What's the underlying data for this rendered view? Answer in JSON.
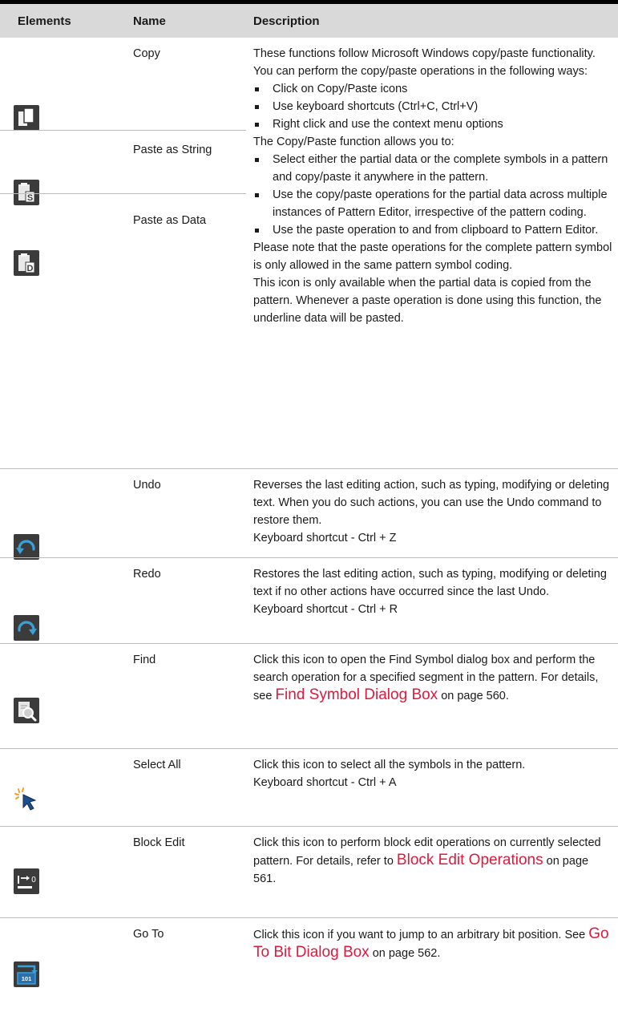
{
  "header": {
    "elements": "Elements",
    "name": "Name",
    "description": "Description"
  },
  "rows": {
    "copy": {
      "name": "Copy",
      "icon": "copy-icon"
    },
    "paste_string": {
      "name": "Paste as String",
      "icon": "paste-string-icon"
    },
    "paste_data": {
      "name": "Paste as Data",
      "icon": "paste-data-icon"
    },
    "copy_paste_desc": {
      "intro": "These functions follow Microsoft Windows copy/paste functionality. You can perform the copy/paste operations in the following ways:",
      "ways": [
        "Click on Copy/Paste icons",
        "Use keyboard shortcuts (Ctrl+C, Ctrl+V)",
        "Right click and use the context menu options"
      ],
      "allows": "The Copy/Paste function allows you to:",
      "allow_items": [
        "Select either the partial data or the complete symbols in a pattern and copy/paste it anywhere in the pattern.",
        "Use the copy/paste operations for the partial data across multiple instances of Pattern Editor, irrespective of the pattern coding.",
        "Use the paste operation to and from clipboard to Pattern Editor."
      ],
      "note": "Please note that the paste operations for the complete pattern symbol is only allowed in the same pattern symbol coding.",
      "paste_data_note": "This icon is only available when the partial data is copied from the pattern. Whenever a paste operation is done using this function, the underline data will be pasted."
    },
    "undo": {
      "name": "Undo",
      "icon": "undo-icon",
      "desc": "Reverses the last editing action, such as typing, modifying or deleting text. When you do such actions, you can use the Undo command to restore them.",
      "shortcut": "Keyboard shortcut - Ctrl + Z"
    },
    "redo": {
      "name": "Redo",
      "icon": "redo-icon",
      "desc": "Restores the last editing action, such as typing, modifying or deleting text if no other actions have occurred since the last Undo.",
      "shortcut": "Keyboard shortcut - Ctrl + R"
    },
    "find": {
      "name": "Find",
      "icon": "find-icon",
      "desc_pre": "Click this icon to open the Find Symbol dialog box and perform the search operation for a specified segment in the pattern. For details, see ",
      "link": "Find Symbol Dialog Box",
      "desc_post": " on page 560."
    },
    "select_all": {
      "name": "Select All",
      "icon": "select-all-icon",
      "desc": "Click this icon to select all the symbols in the pattern.",
      "shortcut": "Keyboard shortcut - Ctrl + A"
    },
    "block_edit": {
      "name": "Block Edit",
      "icon": "block-edit-icon",
      "desc_pre": "Click this icon to perform block edit operations on currently selected pattern. For details, refer to ",
      "link": "Block Edit Operations",
      "desc_post": " on page 561."
    },
    "go_to": {
      "name": "Go To",
      "icon": "go-to-icon",
      "desc_pre": "Click this icon if you want to jump to an arbitrary bit position. See ",
      "link": "Go To Bit Dialog Box",
      "desc_post": " on page 562.",
      "icon_text": "101"
    }
  },
  "colors": {
    "link": "#e0193c",
    "header_bg": "#d9d9d9",
    "icon_bg": "#3b3b3b",
    "accent_blue": "#3aa0d8"
  }
}
